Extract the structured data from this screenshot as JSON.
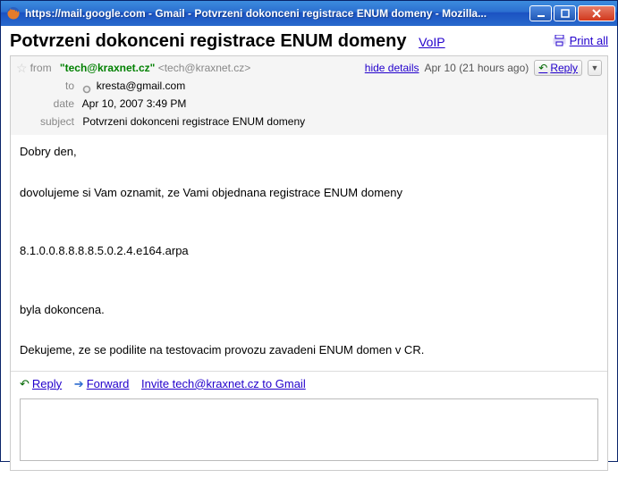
{
  "window": {
    "title": "https://mail.google.com - Gmail - Potvrzeni dokonceni registrace ENUM domeny - Mozilla..."
  },
  "header": {
    "subject": "Potvrzeni dokonceni registrace ENUM domeny",
    "category_link": "VoIP",
    "print_all": "Print all"
  },
  "meta": {
    "from_label": "from",
    "from_name": "\"tech@kraxnet.cz\"",
    "from_addr": "<tech@kraxnet.cz>",
    "hide_details": "hide details",
    "timestamp": "Apr 10 (21 hours ago)",
    "reply_label": "Reply",
    "to_label": "to",
    "to_value": "kresta@gmail.com",
    "date_label": "date",
    "date_value": "Apr 10, 2007 3:49 PM",
    "subject_label": "subject",
    "subject_value": "Potvrzeni dokonceni registrace ENUM domeny"
  },
  "body": {
    "p1": "Dobry den,",
    "p2": "dovolujeme si Vam oznamit, ze Vami objednana registrace ENUM domeny",
    "p3": "8.1.0.0.8.8.8.8.5.0.2.4.e164.arpa",
    "p4": "byla dokoncena.",
    "p5": "Dekujeme, ze se podilite na testovacim provozu zavadeni ENUM domen v CR."
  },
  "actions": {
    "reply": "Reply",
    "forward": "Forward",
    "invite": "Invite tech@kraxnet.cz to Gmail"
  }
}
